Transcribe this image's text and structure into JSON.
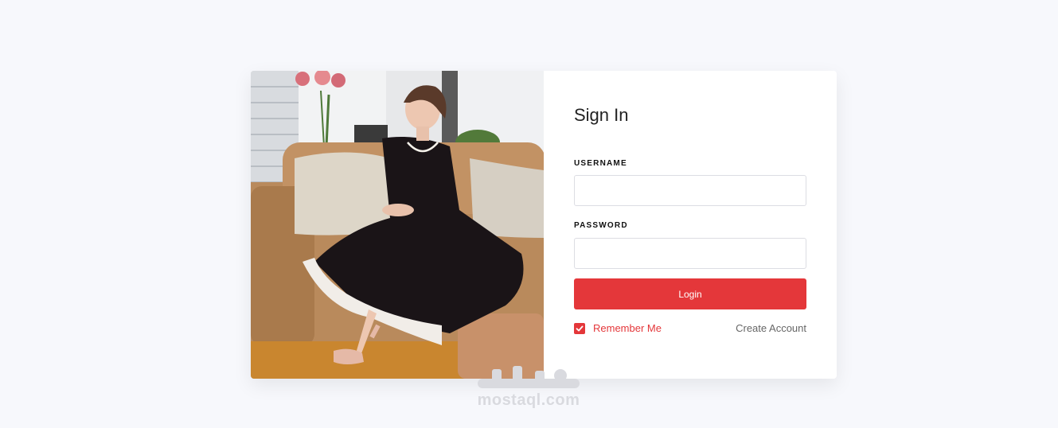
{
  "signin": {
    "title": "Sign In",
    "username_label": "USERNAME",
    "username_value": "",
    "password_label": "PASSWORD",
    "password_value": "",
    "login_label": "Login",
    "remember_label": "Remember Me",
    "remember_checked": true,
    "create_account_label": "Create Account"
  },
  "watermark": {
    "text": "mostaql.com"
  },
  "colors": {
    "accent": "#e4373a",
    "background": "#f7f8fc"
  }
}
